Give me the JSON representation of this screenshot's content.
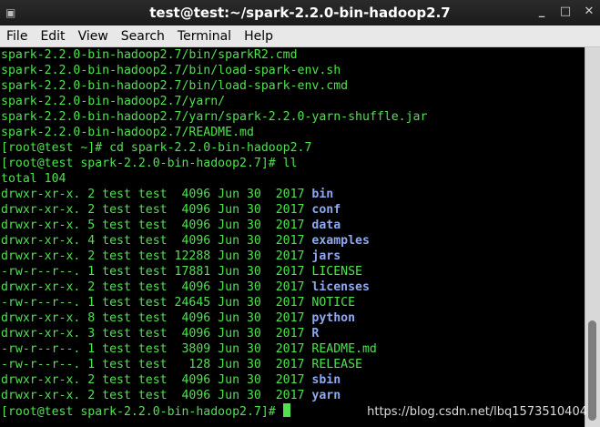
{
  "window": {
    "title": "test@test:~/spark-2.2.0-bin-hadoop2.7",
    "minimize_glyph": "_",
    "maximize_glyph": "□",
    "close_glyph": "✕"
  },
  "menu": [
    "File",
    "Edit",
    "View",
    "Search",
    "Terminal",
    "Help"
  ],
  "terminal": {
    "lines": [
      {
        "text": "spark-2.2.0-bin-hadoop2.7/bin/sparkR2.cmd"
      },
      {
        "text": "spark-2.2.0-bin-hadoop2.7/bin/load-spark-env.sh"
      },
      {
        "text": "spark-2.2.0-bin-hadoop2.7/bin/load-spark-env.cmd"
      },
      {
        "text": "spark-2.2.0-bin-hadoop2.7/yarn/"
      },
      {
        "text": "spark-2.2.0-bin-hadoop2.7/yarn/spark-2.2.0-yarn-shuffle.jar"
      },
      {
        "text": "spark-2.2.0-bin-hadoop2.7/README.md"
      },
      {
        "text": "[root@test ~]# cd spark-2.2.0-bin-hadoop2.7"
      },
      {
        "text": "[root@test spark-2.2.0-bin-hadoop2.7]# ll"
      },
      {
        "text": "total 104"
      },
      {
        "text": "drwxr-xr-x. 2 test test  4096 Jun 30  2017 ",
        "name": "bin",
        "dir": true
      },
      {
        "text": "drwxr-xr-x. 2 test test  4096 Jun 30  2017 ",
        "name": "conf",
        "dir": true
      },
      {
        "text": "drwxr-xr-x. 5 test test  4096 Jun 30  2017 ",
        "name": "data",
        "dir": true
      },
      {
        "text": "drwxr-xr-x. 4 test test  4096 Jun 30  2017 ",
        "name": "examples",
        "dir": true
      },
      {
        "text": "drwxr-xr-x. 2 test test 12288 Jun 30  2017 ",
        "name": "jars",
        "dir": true
      },
      {
        "text": "-rw-r--r--. 1 test test 17881 Jun 30  2017 ",
        "name": "LICENSE",
        "dir": false
      },
      {
        "text": "drwxr-xr-x. 2 test test  4096 Jun 30  2017 ",
        "name": "licenses",
        "dir": true
      },
      {
        "text": "-rw-r--r--. 1 test test 24645 Jun 30  2017 ",
        "name": "NOTICE",
        "dir": false
      },
      {
        "text": "drwxr-xr-x. 8 test test  4096 Jun 30  2017 ",
        "name": "python",
        "dir": true
      },
      {
        "text": "drwxr-xr-x. 3 test test  4096 Jun 30  2017 ",
        "name": "R",
        "dir": true
      },
      {
        "text": "-rw-r--r--. 1 test test  3809 Jun 30  2017 ",
        "name": "README.md",
        "dir": false
      },
      {
        "text": "-rw-r--r--. 1 test test   128 Jun 30  2017 ",
        "name": "RELEASE",
        "dir": false
      },
      {
        "text": "drwxr-xr-x. 2 test test  4096 Jun 30  2017 ",
        "name": "sbin",
        "dir": true
      },
      {
        "text": "drwxr-xr-x. 2 test test  4096 Jun 30  2017 ",
        "name": "yarn",
        "dir": true
      }
    ],
    "prompt": "[root@test spark-2.2.0-bin-hadoop2.7]# "
  },
  "watermark": "https://blog.csdn.net/lbq1573510404",
  "colors": {
    "text": "#4ee34e",
    "directory": "#8fa8f0",
    "background": "#000000"
  },
  "icons": {
    "window_menu": "terminal-icon"
  }
}
